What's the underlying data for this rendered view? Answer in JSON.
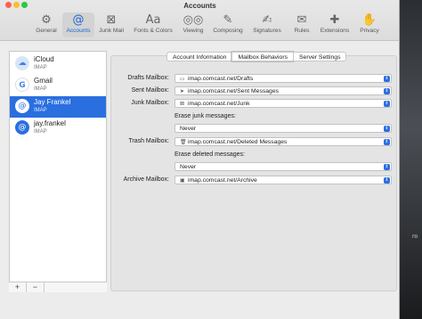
{
  "window": {
    "title": "Accounts"
  },
  "toolbar": {
    "items": [
      {
        "label": "General",
        "icon": "gear-icon",
        "glyph": "⚙"
      },
      {
        "label": "Accounts",
        "icon": "at-icon",
        "glyph": "@"
      },
      {
        "label": "Junk Mail",
        "icon": "junk-tray-icon",
        "glyph": "⊠"
      },
      {
        "label": "Fonts & Colors",
        "icon": "font-icon",
        "glyph": "Aa"
      },
      {
        "label": "Viewing",
        "icon": "glasses-icon",
        "glyph": "◎◎"
      },
      {
        "label": "Composing",
        "icon": "compose-icon",
        "glyph": "✎"
      },
      {
        "label": "Signatures",
        "icon": "signature-icon",
        "glyph": "✍"
      },
      {
        "label": "Rules",
        "icon": "rules-envelope-icon",
        "glyph": "✉"
      },
      {
        "label": "Extensions",
        "icon": "puzzle-icon",
        "glyph": "✚"
      },
      {
        "label": "Privacy",
        "icon": "hand-icon",
        "glyph": "✋"
      }
    ],
    "active": "Accounts"
  },
  "sidebar": {
    "accounts": [
      {
        "name": "iCloud",
        "type": "IMAP",
        "icon": "icloud-icon",
        "glyph": "☁",
        "color": "#d7e6f7"
      },
      {
        "name": "Gmail",
        "type": "IMAP",
        "icon": "google-icon",
        "glyph": "G",
        "color": "#ffffff"
      },
      {
        "name": "Jay Frankel",
        "type": "IMAP",
        "icon": "at-icon",
        "glyph": "@",
        "color": "#ffffff"
      },
      {
        "name": "jay.frankel",
        "type": "IMAP",
        "icon": "at-icon",
        "glyph": "@",
        "color": "#2a6fe0"
      }
    ],
    "selected": "Jay Frankel",
    "add_label": "+",
    "remove_label": "−"
  },
  "tabs": [
    "Account Information",
    "Mailbox Behaviors",
    "Server Settings"
  ],
  "active_tab": "Mailbox Behaviors",
  "mailbox": {
    "drafts_label": "Drafts Mailbox:",
    "drafts_value": "imap.comcast.net/Drafts",
    "sent_label": "Sent Mailbox:",
    "sent_value": "imap.comcast.net/Sent Messages",
    "junk_label": "Junk Mailbox:",
    "junk_value": "imap.comcast.net/Junk",
    "erase_junk_label": "Erase junk messages:",
    "erase_junk_value": "Never",
    "trash_label": "Trash Mailbox:",
    "trash_value": "imap.comcast.net/Deleted Messages",
    "erase_deleted_label": "Erase deleted messages:",
    "erase_deleted_value": "Never",
    "archive_label": "Archive Mailbox:",
    "archive_value": "imap.comcast.net/Archive"
  },
  "colors": {
    "accent": "#2a6fe0",
    "selection": "#2a6fe0"
  },
  "background_fragment": "ro"
}
